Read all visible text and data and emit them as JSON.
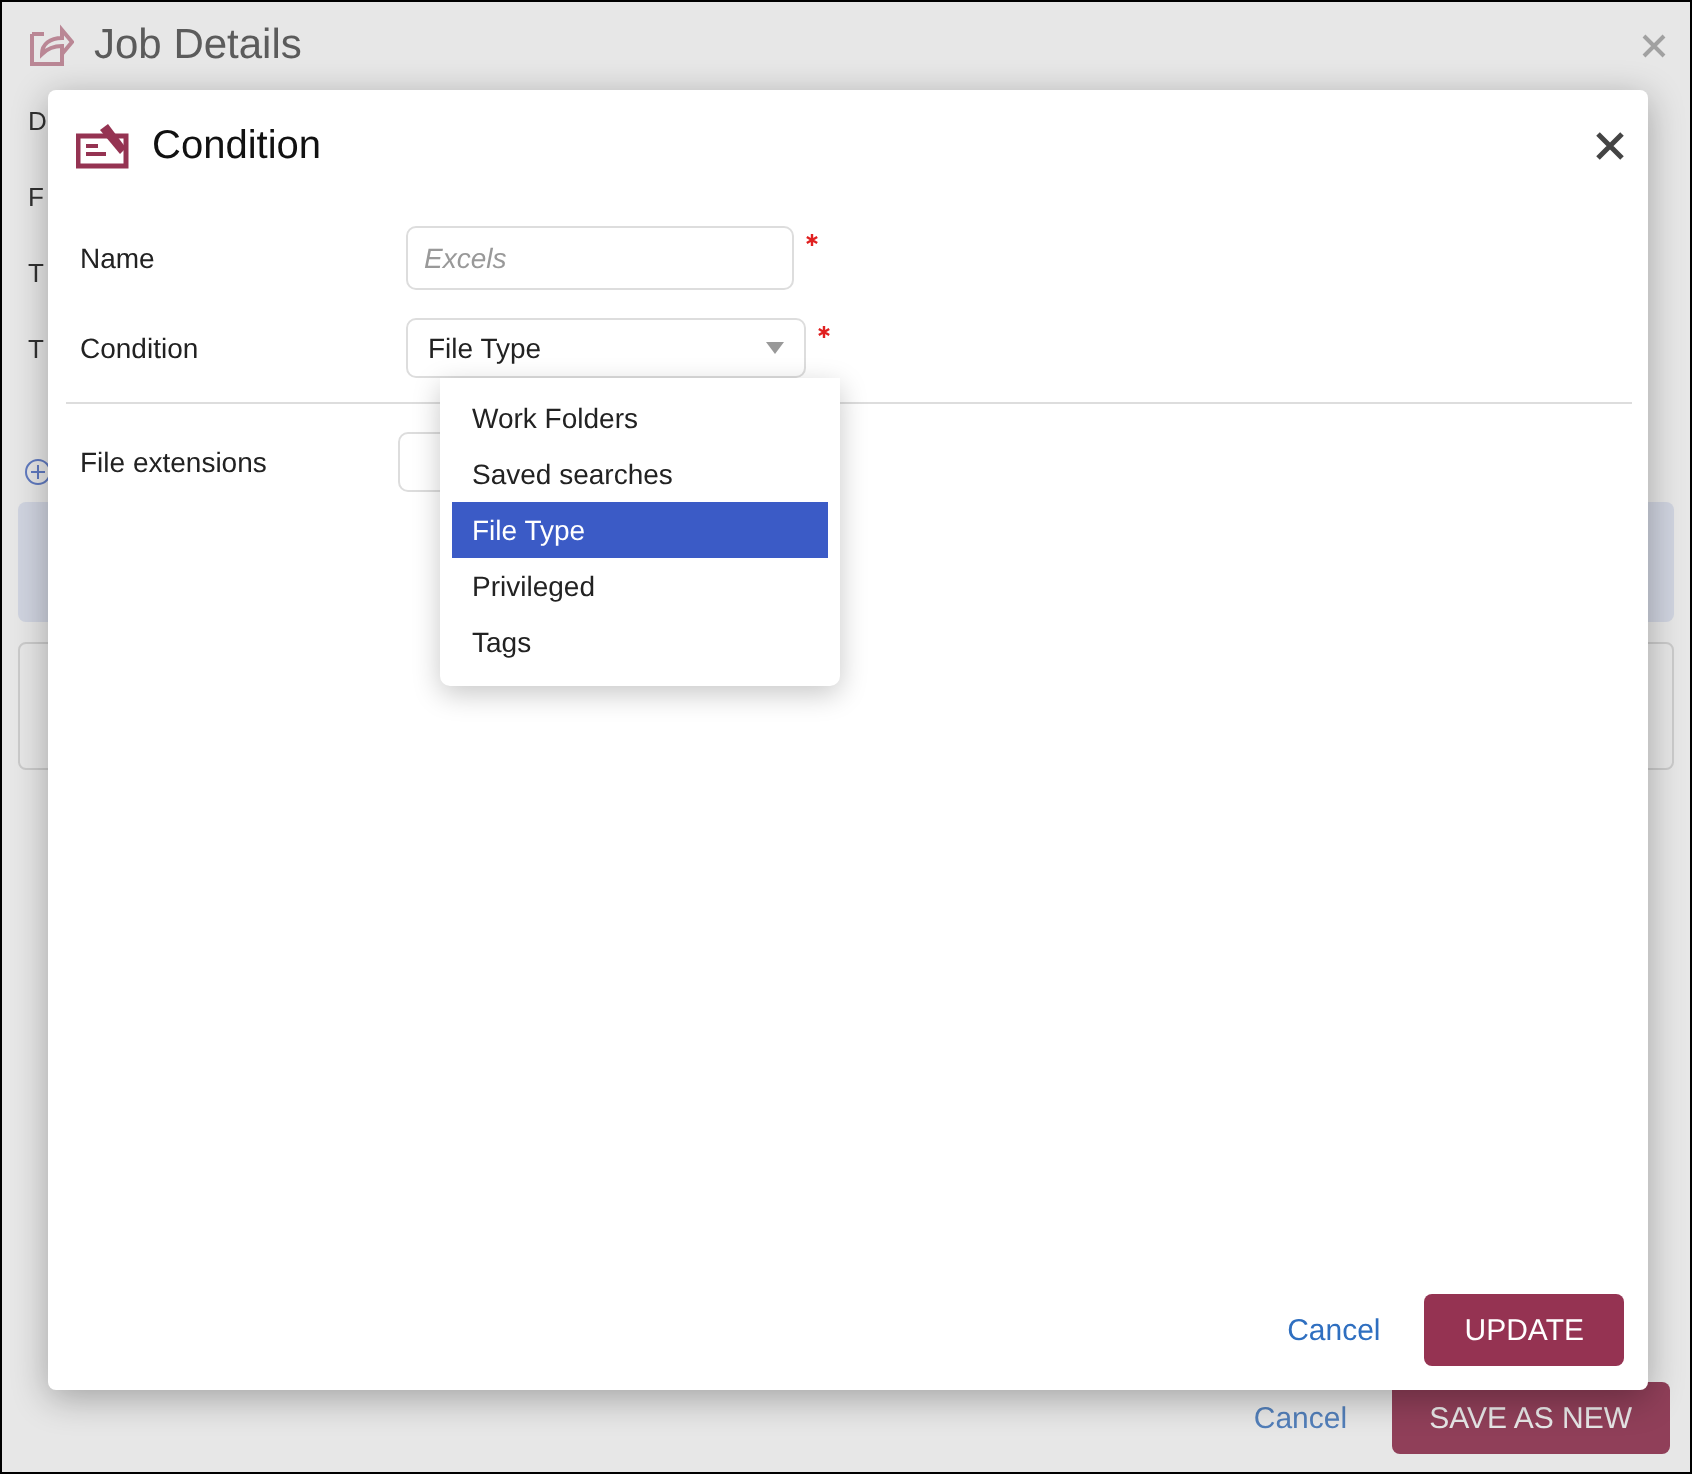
{
  "background": {
    "title": "Job Details",
    "side_labels": [
      "D",
      "F",
      "T",
      "T"
    ],
    "cancel": "Cancel",
    "save": "SAVE AS NEW"
  },
  "dialog": {
    "title": "Condition",
    "fields": [
      {
        "kind": "text",
        "label": "Name",
        "placeholder": "Excels",
        "required": true
      },
      {
        "kind": "select",
        "label": "Condition",
        "value": "File Type",
        "required": true,
        "expanded": true,
        "options": [
          {
            "label": "Work Folders",
            "selected": false
          },
          {
            "label": "Saved searches",
            "selected": false
          },
          {
            "label": "File Type",
            "selected": true
          },
          {
            "label": "Privileged",
            "selected": false
          },
          {
            "label": "Tags",
            "selected": false
          }
        ]
      }
    ],
    "extensions": {
      "label": "File extensions"
    },
    "cancel": "Cancel",
    "update": "UPDATE"
  }
}
